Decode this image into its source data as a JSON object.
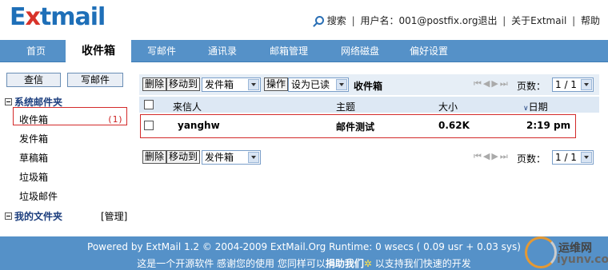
{
  "logo": {
    "prefix": "E",
    "x": "x",
    "suffix": "tmail"
  },
  "top": {
    "search": "搜索",
    "username_label": "用户名：",
    "username": "001@postfix.org",
    "logout": "退出",
    "about": "关于Extmail",
    "help": "帮助"
  },
  "tabs": [
    "首页",
    "收件箱",
    "写邮件",
    "通讯录",
    "邮箱管理",
    "网络磁盘",
    "偏好设置"
  ],
  "sidebar": {
    "check_mail": "查信",
    "compose": "写邮件",
    "system_folders": "系统邮件夹",
    "folders": [
      "收件箱",
      "发件箱",
      "草稿箱",
      "垃圾箱",
      "垃圾邮件"
    ],
    "inbox_count": "(1)",
    "my_folders": "我的文件夹",
    "manage": "[管理]"
  },
  "toolbar": {
    "delete": "删除",
    "move_to": "移动到",
    "move_target": "发件箱",
    "operate": "操作",
    "mark_as": "设为已读",
    "folder_name": "收件箱",
    "pages_label": "页数：",
    "page": "1 / 1"
  },
  "list": {
    "headers": {
      "from": "来信人",
      "subject": "主题",
      "size": "大小",
      "date": "日期"
    },
    "rows": [
      {
        "from": "yanghw",
        "subject": "邮件测试",
        "size": "0.62K",
        "date": "2:19 pm"
      }
    ]
  },
  "footer": {
    "line1": "Powered by ExtMail 1.2 © 2004-2009 ExtMail.Org Runtime: 0 wsecs ( 0.09 usr + 0.03 sys)",
    "line2_a": "这是一个开源软件 感谢您的使用 您同样可以",
    "donate": "捐助我们",
    "star": "✲",
    "line2_b": " 以支持我们快速的开发"
  },
  "watermark": {
    "t1": "运维网",
    "t2": "iyunv.com"
  }
}
